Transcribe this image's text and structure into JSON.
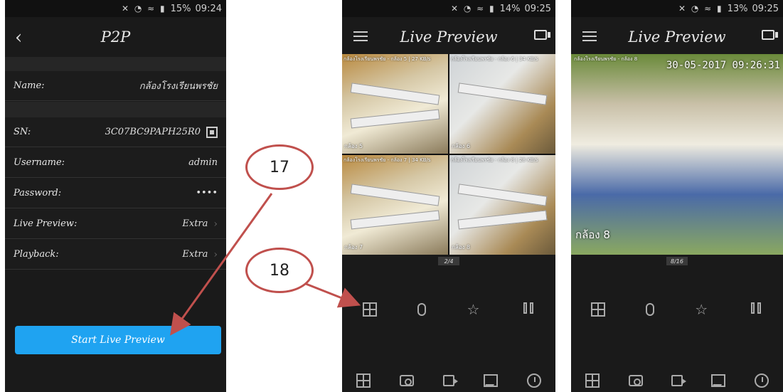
{
  "phone1": {
    "status": {
      "icons": "✕ ◔ ≈ ▮",
      "battery": "15%",
      "time": "09:24"
    },
    "title": "P2P",
    "rows": [
      {
        "label": "Name:",
        "value": "กล้องโรงเรียนพรชัย"
      },
      {
        "label": "SN:",
        "value": "3C07BC9PAPH25R0"
      },
      {
        "label": "Username:",
        "value": "admin"
      },
      {
        "label": "Password:",
        "value": "••••"
      },
      {
        "label": "Live Preview:",
        "value": "Extra"
      },
      {
        "label": "Playback:",
        "value": "Extra"
      }
    ],
    "start_button": "Start Live Preview"
  },
  "phone2": {
    "status": {
      "icons": "✕ ◔ ≈ ▮",
      "battery": "14%",
      "time": "09:25"
    },
    "title": "Live Preview",
    "cells": [
      {
        "caption": "กล้องโรงเรียนพรชัย - กล้อง 5 | 27 KB/s",
        "name": "กล้อง 5"
      },
      {
        "caption": "กล้องโรงเรียนพรชัย - กล้อง 6 | 34 KB/s",
        "name": "กล้อง 6"
      },
      {
        "caption": "กล้องโรงเรียนพรชัย - กล้อง 7 | 34 KB/s",
        "name": "กล้อง 7"
      },
      {
        "caption": "กล้องโรงเรียนพรชัย - กล้อง 8 | 28 KB/s",
        "name": "กล้อง 8"
      }
    ],
    "page": "2/4"
  },
  "phone3": {
    "status": {
      "icons": "✕ ◔ ≈ ▮",
      "battery": "13%",
      "time": "09:25"
    },
    "title": "Live Preview",
    "caption": "กล้องโรงเรียนพรชัย - กล้อง 8",
    "timestamp": "30-05-2017 09:26:31",
    "camera_name": "กล้อง 8",
    "page": "8/16"
  },
  "callouts": {
    "a": "17",
    "b": "18"
  },
  "colors": {
    "accent": "#1fa3f1",
    "callout_border": "#c0504d"
  }
}
